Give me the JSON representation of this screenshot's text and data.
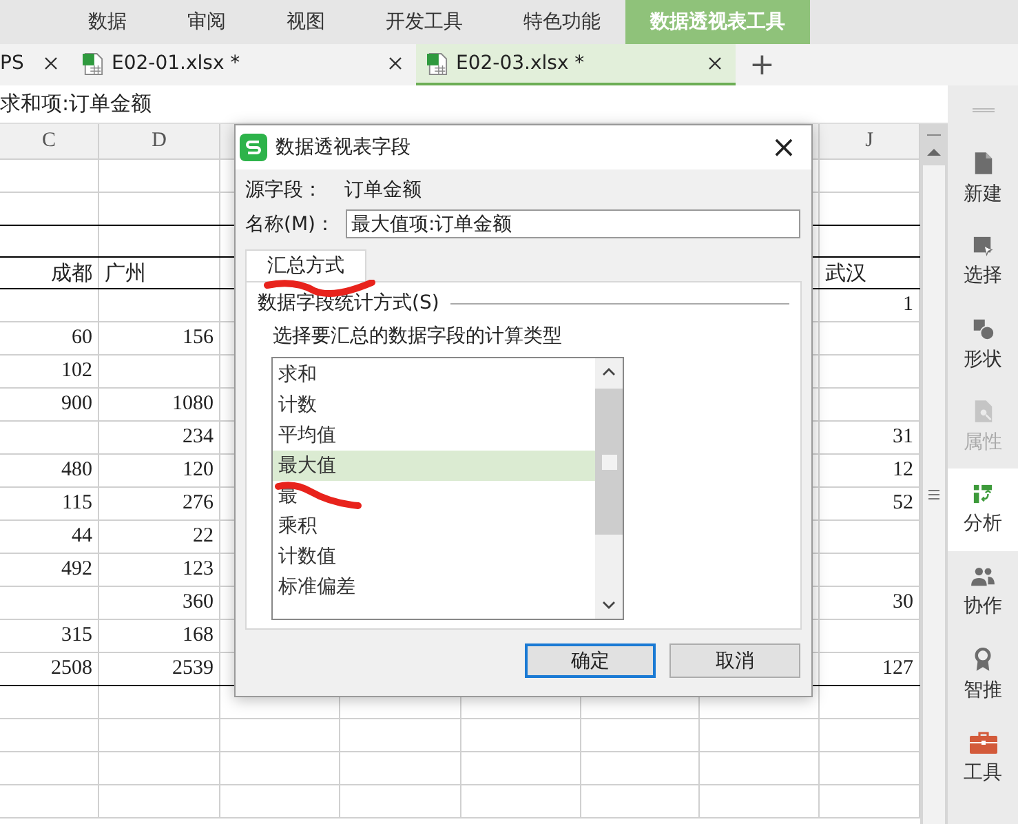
{
  "ribbon_tabs": [
    {
      "label": "数据",
      "selected": false
    },
    {
      "label": "审阅",
      "selected": false
    },
    {
      "label": "视图",
      "selected": false
    },
    {
      "label": "开发工具",
      "selected": false
    },
    {
      "label": "特色功能",
      "selected": false
    },
    {
      "label": "数据透视表工具",
      "selected": true
    }
  ],
  "doc_tabs": [
    {
      "label": "PS",
      "kind": "plain",
      "selected": false
    },
    {
      "label": "E02-01.xlsx *",
      "kind": "sheet",
      "selected": false
    },
    {
      "label": "E02-03.xlsx *",
      "kind": "sheet",
      "selected": true
    }
  ],
  "new_tab_button": "+",
  "formula_bar": {
    "text": "求和项:订单金额"
  },
  "sheet": {
    "columns": [
      {
        "label": "C"
      },
      {
        "label": "D"
      },
      {},
      {},
      {},
      {},
      {},
      {
        "label": "J"
      }
    ],
    "rows": [
      {
        "kind": "plain",
        "cells": [
          null,
          null,
          null,
          null,
          null,
          null,
          null,
          null
        ]
      },
      {
        "kind": "plain",
        "cells": [
          null,
          null,
          null,
          null,
          null,
          null,
          null,
          null
        ]
      },
      {
        "kind": "title",
        "cells": [
          null,
          null,
          null,
          null,
          null,
          null,
          null,
          null
        ]
      },
      {
        "kind": "header",
        "cells": [
          "成都",
          "广州",
          null,
          null,
          null,
          null,
          null,
          "武汉"
        ]
      },
      {
        "kind": "plain",
        "cells": [
          null,
          null,
          null,
          null,
          null,
          null,
          null,
          "1"
        ]
      },
      {
        "kind": "plain",
        "cells": [
          "60",
          "156",
          null,
          null,
          null,
          null,
          null,
          null
        ]
      },
      {
        "kind": "plain",
        "cells": [
          "102",
          null,
          null,
          null,
          null,
          null,
          null,
          null
        ]
      },
      {
        "kind": "plain",
        "cells": [
          "900",
          "1080",
          null,
          null,
          null,
          null,
          null,
          null
        ]
      },
      {
        "kind": "plain",
        "cells": [
          null,
          "234",
          null,
          null,
          null,
          null,
          null,
          "31"
        ]
      },
      {
        "kind": "plain",
        "cells": [
          "480",
          "120",
          null,
          null,
          null,
          null,
          null,
          "12"
        ]
      },
      {
        "kind": "plain",
        "cells": [
          "115",
          "276",
          null,
          null,
          null,
          null,
          null,
          "52"
        ]
      },
      {
        "kind": "plain",
        "cells": [
          "44",
          "22",
          null,
          null,
          null,
          null,
          null,
          null
        ]
      },
      {
        "kind": "plain",
        "cells": [
          "492",
          "123",
          null,
          null,
          null,
          null,
          null,
          null
        ]
      },
      {
        "kind": "plain",
        "cells": [
          null,
          "360",
          null,
          null,
          null,
          null,
          null,
          "30"
        ]
      },
      {
        "kind": "plain",
        "cells": [
          "315",
          "168",
          null,
          null,
          null,
          null,
          null,
          null
        ]
      },
      {
        "kind": "total",
        "cells": [
          "2508",
          "2539",
          null,
          null,
          null,
          null,
          null,
          "127"
        ]
      },
      {
        "kind": "plain",
        "cells": [
          null,
          null,
          null,
          null,
          null,
          null,
          null,
          null
        ]
      },
      {
        "kind": "plain",
        "cells": [
          null,
          null,
          null,
          null,
          null,
          null,
          null,
          null
        ]
      },
      {
        "kind": "plain",
        "cells": [
          null,
          null,
          null,
          null,
          null,
          null,
          null,
          null
        ]
      },
      {
        "kind": "plain",
        "cells": [
          null,
          null,
          null,
          null,
          null,
          null,
          null,
          null
        ]
      }
    ]
  },
  "dialog": {
    "title": "数据透视表字段",
    "close": "×",
    "source_label": "源字段：",
    "source_value": "订单金额",
    "name_label": "名称(M)：",
    "name_value": "最大值项:订单金额",
    "tabs": [
      {
        "label": "汇总方式",
        "selected": true
      }
    ],
    "group_label": "数据字段统计方式(S)",
    "instruction": "选择要汇总的数据字段的计算类型",
    "items": [
      {
        "label": "求和",
        "selected": false
      },
      {
        "label": "计数",
        "selected": false
      },
      {
        "label": "平均值",
        "selected": false
      },
      {
        "label": "最大值",
        "selected": true
      },
      {
        "label": "最",
        "selected": false
      },
      {
        "label": "乘积",
        "selected": false
      },
      {
        "label": "计数值",
        "selected": false
      },
      {
        "label": "标准偏差",
        "selected": false
      }
    ],
    "buttons": [
      {
        "label": "确定",
        "kind": "primary"
      },
      {
        "label": "取消",
        "kind": "normal"
      }
    ]
  },
  "sidebar": [
    {
      "label": "新建",
      "kind": "new",
      "selected": false,
      "disabled": false
    },
    {
      "label": "选择",
      "kind": "select",
      "selected": false,
      "disabled": false
    },
    {
      "label": "形状",
      "kind": "shape",
      "selected": false,
      "disabled": false
    },
    {
      "label": "属性",
      "kind": "property",
      "selected": false,
      "disabled": true
    },
    {
      "label": "分析",
      "kind": "analyze",
      "selected": true,
      "disabled": false
    },
    {
      "label": "协作",
      "kind": "people",
      "selected": false,
      "disabled": false
    },
    {
      "label": "智推",
      "kind": "badge",
      "selected": false,
      "disabled": false
    },
    {
      "label": "工具",
      "kind": "toolbox",
      "selected": false,
      "disabled": false
    }
  ]
}
